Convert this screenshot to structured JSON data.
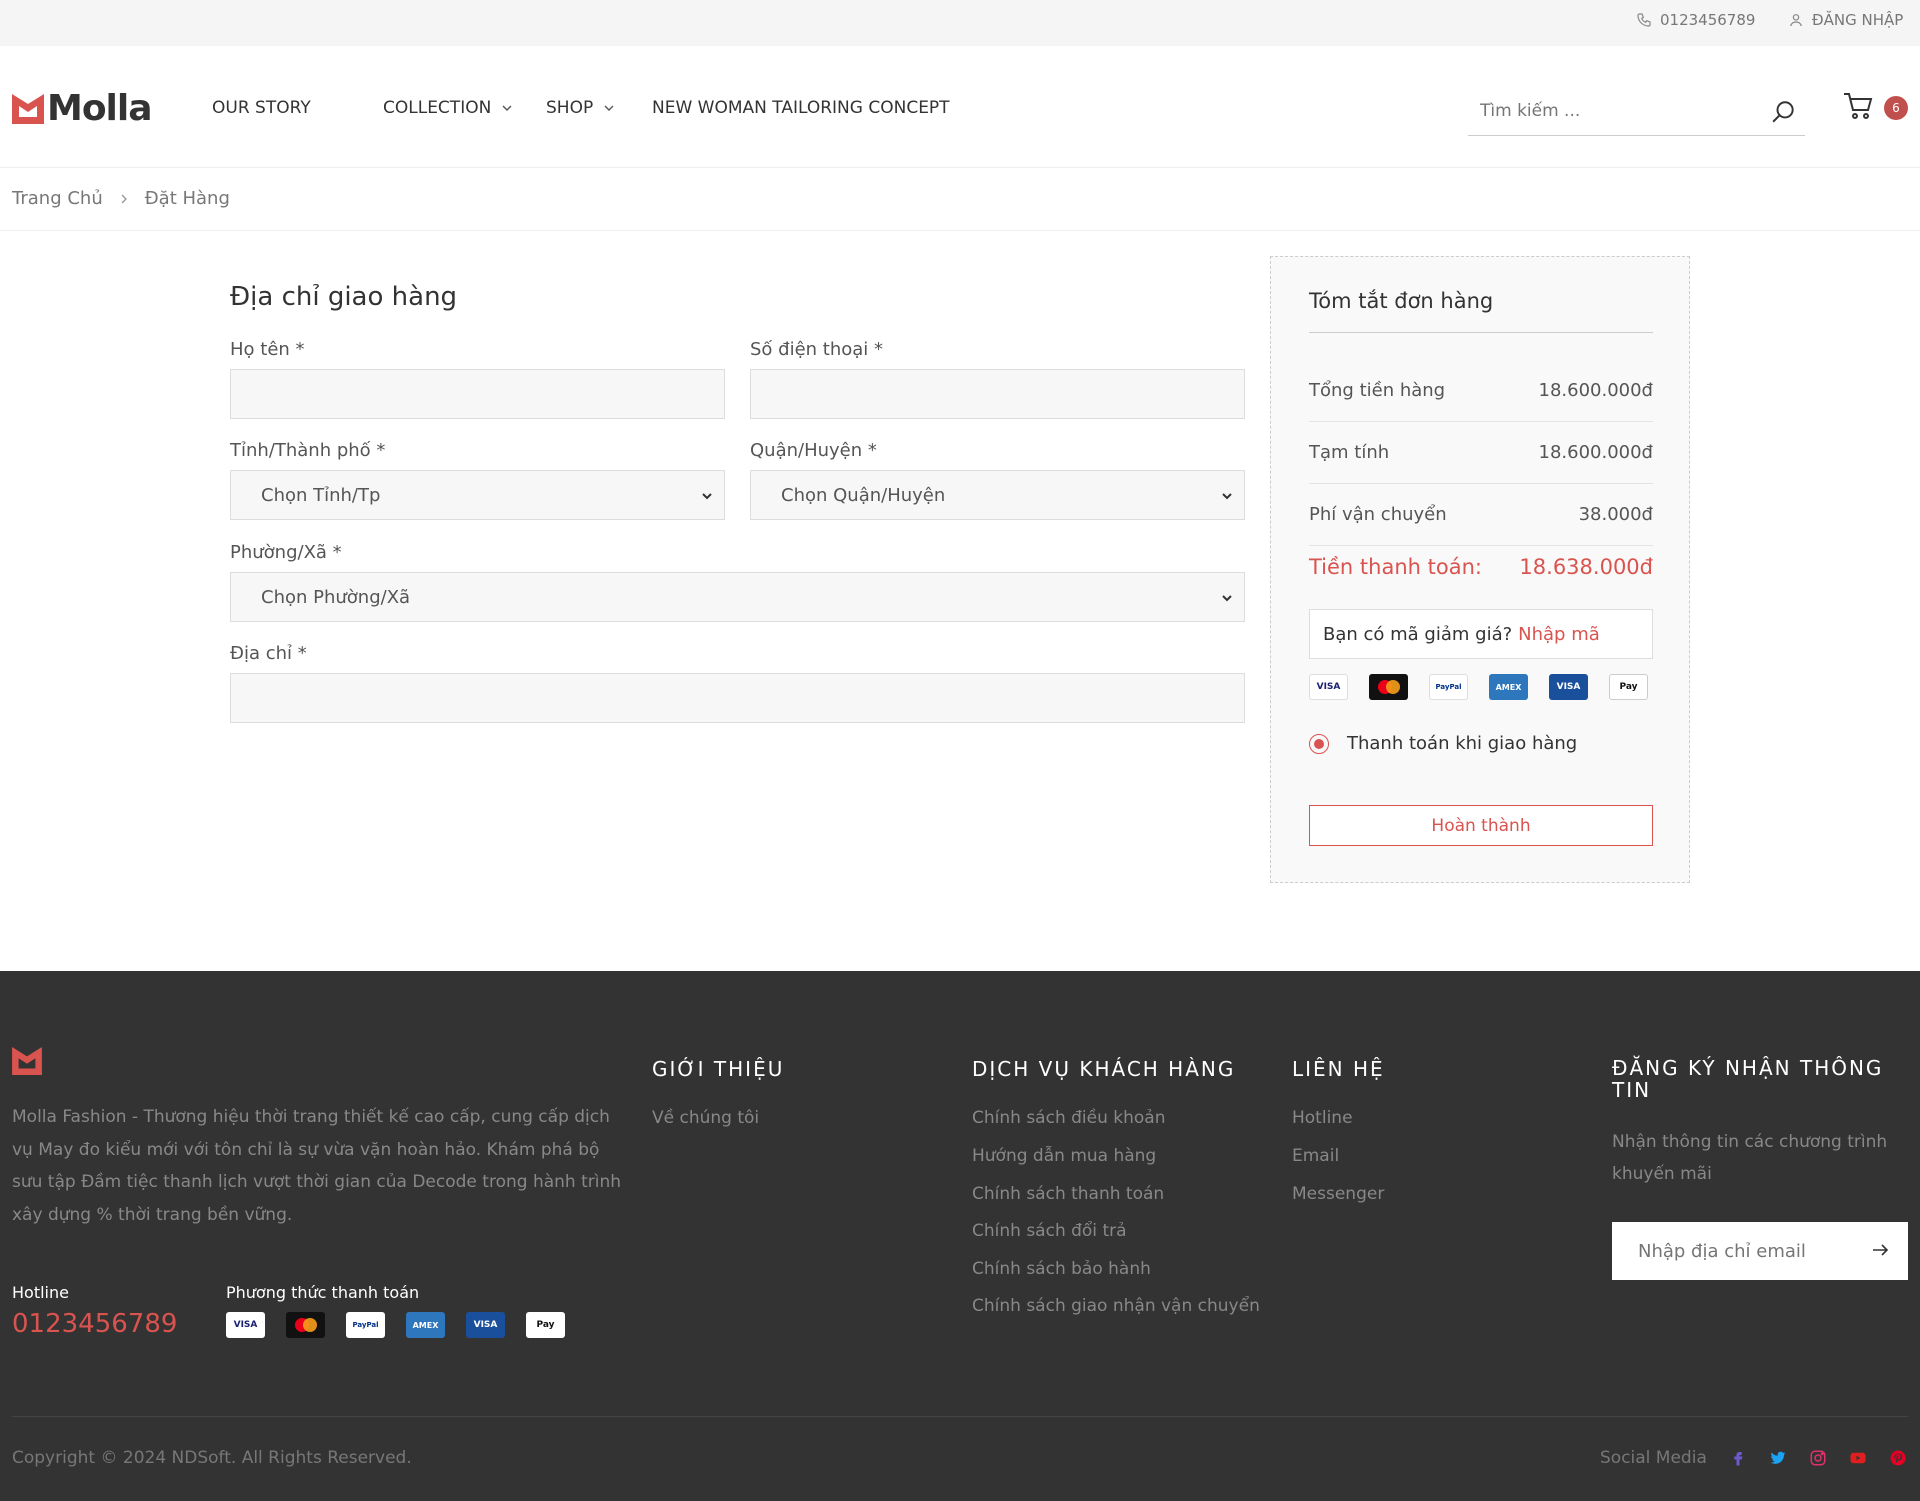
{
  "topbar": {
    "phone": "0123456789",
    "login": "ĐĂNG NHẬP"
  },
  "header": {
    "brand": "Molla",
    "nav": [
      {
        "label": "OUR STORY",
        "has_dropdown": false
      },
      {
        "label": "COLLECTION",
        "has_dropdown": true
      },
      {
        "label": "SHOP",
        "has_dropdown": true
      },
      {
        "label": "NEW WOMAN TAILORING CONCEPT",
        "has_dropdown": false
      }
    ],
    "search_placeholder": "Tìm kiếm ...",
    "cart_count": "6"
  },
  "breadcrumb": {
    "home": "Trang Chủ",
    "current": "Đặt Hàng"
  },
  "form": {
    "title": "Địa chỉ giao hàng",
    "fullname_label": "Họ tên *",
    "phone_label": "Số điện thoại *",
    "province_label": "Tỉnh/Thành phố *",
    "province_value": "Chọn Tỉnh/Tp",
    "district_label": "Quận/Huyện *",
    "district_value": "Chọn Quận/Huyện",
    "ward_label": "Phường/Xã *",
    "ward_value": "Chọn Phường/Xã",
    "address_label": "Địa chỉ *"
  },
  "summary": {
    "title": "Tóm tắt đơn hàng",
    "rows": [
      {
        "label": "Tổng tiền hàng",
        "value": "18.600.000đ"
      },
      {
        "label": "Tạm tính",
        "value": "18.600.000đ"
      },
      {
        "label": "Phí vận chuyển",
        "value": "38.000đ"
      }
    ],
    "total_label": "Tiền thanh toán:",
    "total_value": "18.638.000đ",
    "coupon_text": "Bạn có mã giảm giá?",
    "coupon_link": "Nhập mã",
    "payment_method": "Thanh toán khi giao hàng",
    "submit": "Hoàn thành"
  },
  "payment_icons": [
    {
      "label": "VISA",
      "bg": "#ffffff",
      "fg": "#1a1f71"
    },
    {
      "label": "",
      "bg": "#111111",
      "fg": "#ffffff"
    },
    {
      "label": "PayPal",
      "bg": "#ffffff",
      "fg": "#003087"
    },
    {
      "label": "AMEX",
      "bg": "#2e77bc",
      "fg": "#ffffff"
    },
    {
      "label": "VISA",
      "bg": "#1a4f9c",
      "fg": "#ffffff"
    },
    {
      "label": "Pay",
      "bg": "#ffffff",
      "fg": "#111111"
    }
  ],
  "footer": {
    "description": "Molla Fashion - Thương hiệu thời trang thiết kế cao cấp, cung cấp dịch vụ May đo kiểu mới với tôn chỉ là sự vừa vặn hoàn hảo. Khám phá bộ sưu tập Đầm tiệc thanh lịch vượt thời gian của Decode trong hành trình xây dựng % thời trang bền vững.",
    "hotline_label": "Hotline",
    "hotline": "0123456789",
    "payment_label": "Phương thức thanh toán",
    "about_title": "GIỚI THIỆU",
    "about_links": [
      "Về chúng tôi"
    ],
    "service_title": "DỊCH VỤ KHÁCH HÀNG",
    "service_links": [
      "Chính sách điều khoản",
      "Hướng dẫn mua hàng",
      "Chính sách thanh toán",
      "Chính sách đổi trả",
      "Chính sách bảo hành",
      "Chính sách giao nhận vận chuyển"
    ],
    "contact_title": "LIÊN HỆ",
    "contact_links": [
      "Hotline",
      "Email",
      "Messenger"
    ],
    "newsletter_title": "ĐĂNG KÝ NHẬN THÔNG TIN",
    "newsletter_text": "Nhận thông tin các chương trình khuyến mãi",
    "email_placeholder": "Nhập địa chỉ email",
    "copyright": "Copyright © 2024 NDSoft. All Rights Reserved.",
    "social_label": "Social Media"
  },
  "colors": {
    "accent": "#d9534f",
    "footer_bg": "#333333",
    "logo": "#d9534f"
  }
}
